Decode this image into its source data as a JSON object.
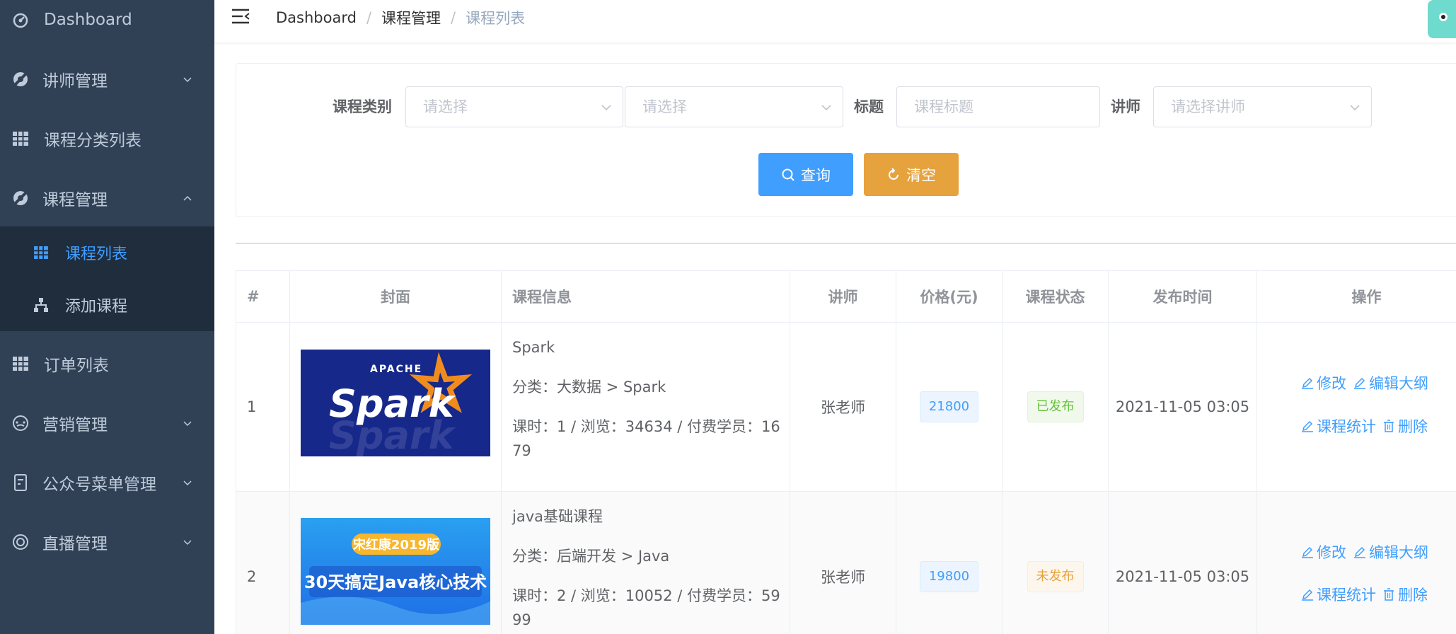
{
  "sidebar": {
    "items": [
      {
        "label": "Dashboard"
      },
      {
        "label": "讲师管理"
      },
      {
        "label": "课程分类列表"
      },
      {
        "label": "课程管理"
      },
      {
        "label": "订单列表"
      },
      {
        "label": "营销管理"
      },
      {
        "label": "公众号菜单管理"
      },
      {
        "label": "直播管理"
      }
    ],
    "sub_items": [
      {
        "label": "课程列表"
      },
      {
        "label": "添加课程"
      }
    ]
  },
  "breadcrumb": [
    "Dashboard",
    "/",
    "课程管理",
    "/",
    "课程列表"
  ],
  "search": {
    "category_label": "课程类别",
    "category_placeholder_1": "请选择",
    "category_placeholder_2": "请选择",
    "title_label": "标题",
    "title_placeholder": "课程标题",
    "teacher_label": "讲师",
    "teacher_placeholder": "请选择讲师",
    "query_button": "查询",
    "clear_button": "清空"
  },
  "table": {
    "headers": [
      "#",
      "封面",
      "课程信息",
      "讲师",
      "价格(元)",
      "课程状态",
      "发布时间",
      "操作"
    ],
    "rows": [
      {
        "index": "1",
        "cover_text": "Spark",
        "cover_subtext": "APACHE",
        "title": "Spark",
        "category": "分类：大数据 > Spark",
        "stats": "课时：1 / 浏览：34634 / 付费学员：1679",
        "teacher": "张老师",
        "price": "21800",
        "status": "已发布",
        "publish_time": "2021-11-05 03:05"
      },
      {
        "index": "2",
        "cover_badge": "宋红康2019版",
        "cover_text": "30天搞定Java核心技术",
        "title": "java基础课程",
        "category": "分类：后端开发 > Java",
        "stats": "课时：2 / 浏览：10052 / 付费学员：5999",
        "teacher": "张老师",
        "price": "19800",
        "status": "未发布",
        "publish_time": "2021-11-05 03:05"
      }
    ],
    "actions": {
      "edit": "修改",
      "edit_outline": "编辑大纲",
      "stats": "课程统计",
      "delete": "删除"
    }
  },
  "colors": {
    "sidebar_bg": "#304156",
    "submenu_bg": "#1f2d3d",
    "active": "#409eff",
    "warning": "#e6a23c",
    "success": "#67c23a"
  }
}
